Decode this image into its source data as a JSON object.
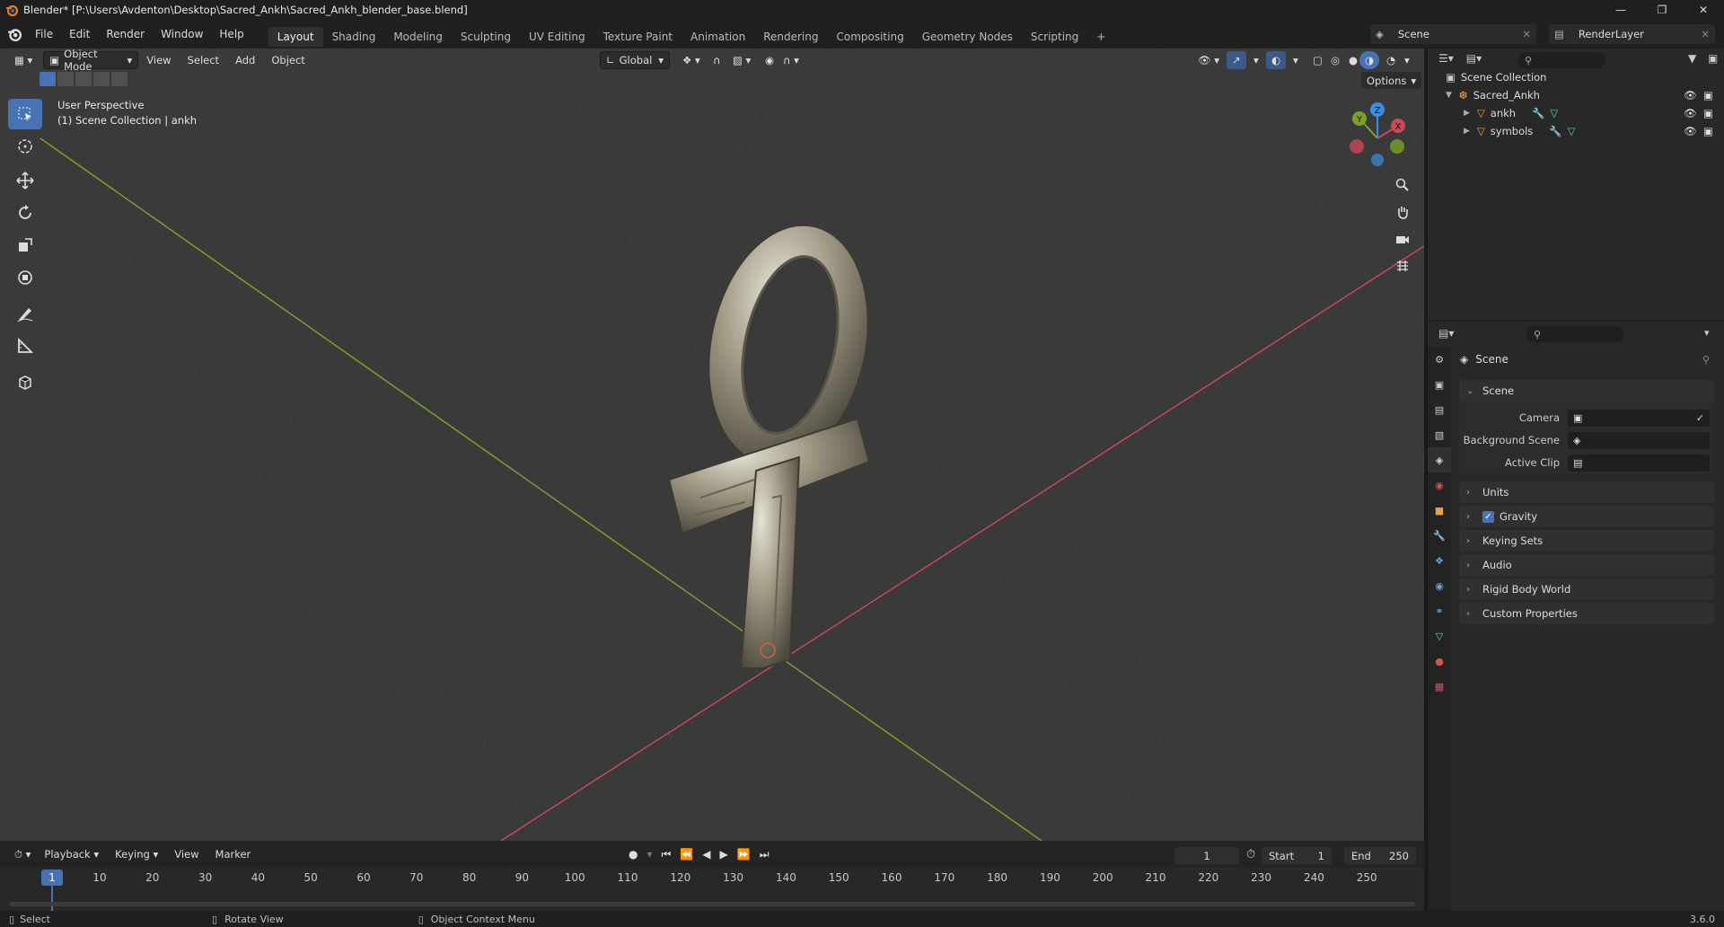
{
  "window": {
    "title": "Blender* [P:\\Users\\Avdenton\\Desktop\\Sacred_Ankh\\Sacred_Ankh_blender_base.blend]",
    "controls": [
      "—",
      "❐",
      "✕"
    ]
  },
  "menu": [
    "File",
    "Edit",
    "Render",
    "Window",
    "Help"
  ],
  "workspaces": [
    "Layout",
    "Shading",
    "Modeling",
    "Sculpting",
    "UV Editing",
    "Texture Paint",
    "Animation",
    "Rendering",
    "Compositing",
    "Geometry Nodes",
    "Scripting",
    "+"
  ],
  "scene_selector": "Scene",
  "view_layer": "RenderLayer",
  "viewport": {
    "mode": "Object Mode",
    "menus": [
      "View",
      "Select",
      "Add",
      "Object"
    ],
    "orientation": "Global",
    "options": "Options",
    "perspective": "User Perspective",
    "collection_info": "(1) Scene Collection | ankh",
    "gizmo": {
      "x": "X",
      "y": "Y",
      "z": "Z"
    }
  },
  "outliner": {
    "root": "Scene Collection",
    "collection": "Sacred_Ankh",
    "objects": [
      "ankh",
      "symbols"
    ]
  },
  "properties": {
    "context": "Scene",
    "panel": "Scene",
    "fields": {
      "camera": "Camera",
      "background_scene": "Background Scene",
      "active_clip": "Active Clip"
    },
    "sections": [
      "Units",
      "Gravity",
      "Keying Sets",
      "Audio",
      "Rigid Body World",
      "Custom Properties"
    ],
    "gravity_checked": true
  },
  "timeline": {
    "menus": [
      "Playback",
      "Keying",
      "View",
      "Marker"
    ],
    "current_frame": "1",
    "start_label": "Start",
    "start": "1",
    "end_label": "End",
    "end": "250",
    "ticks": [
      "1",
      "10",
      "20",
      "30",
      "40",
      "50",
      "60",
      "70",
      "80",
      "90",
      "100",
      "110",
      "120",
      "130",
      "140",
      "150",
      "160",
      "170",
      "180",
      "190",
      "200",
      "210",
      "220",
      "230",
      "240",
      "250"
    ]
  },
  "statusbar": {
    "select": "Select",
    "rotate": "Rotate View",
    "context_menu": "Object Context Menu",
    "version": "3.6.0"
  },
  "colors": {
    "accent": "#4772b3",
    "x_axis": "#d94a5a",
    "y_axis": "#8ab51e",
    "z_axis": "#3d8ee0"
  }
}
